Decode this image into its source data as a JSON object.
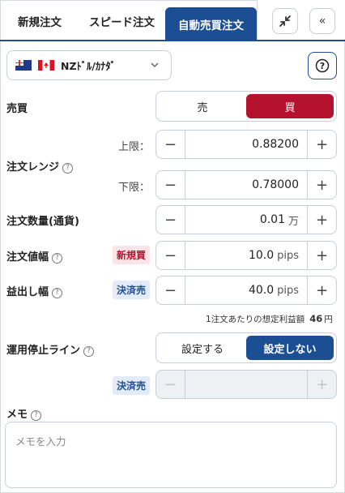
{
  "tabs": [
    {
      "label": "新規注文"
    },
    {
      "label": "スピード注文"
    },
    {
      "label": "自動売買注文"
    }
  ],
  "toolbar": {
    "back_label": "«"
  },
  "pair": {
    "name": "NZﾄﾞﾙ/ｶﾅﾀﾞ"
  },
  "trade": {
    "label": "売買",
    "sell_label": "売",
    "buy_label": "買",
    "selected": "買"
  },
  "range": {
    "label": "注文レンジ",
    "upper_label": "上限：",
    "upper_value": "0.88200",
    "lower_label": "下限：",
    "lower_value": "0.78000"
  },
  "quantity": {
    "label": "注文数量(通貨)",
    "value": "0.01",
    "unit": "万"
  },
  "order_width": {
    "label": "注文値幅",
    "badge": "新規買",
    "value": "10.0",
    "unit": "pips"
  },
  "profit_width": {
    "label": "益出し幅",
    "badge": "決済売",
    "value": "40.0",
    "unit": "pips"
  },
  "profit_note": {
    "text": "1注文あたりの想定利益額",
    "amount": "46",
    "unit": "円"
  },
  "stop_line": {
    "label": "運用停止ライン",
    "on_label": "設定する",
    "off_label": "設定しない",
    "selected": "設定しない",
    "badge": "決済売"
  },
  "memo": {
    "label": "メモ",
    "placeholder": "メモを入力"
  },
  "stepper": {
    "minus": "−",
    "plus": "+"
  },
  "help": {
    "glyph": "?"
  },
  "colors": {
    "accent": "#1c4e94",
    "buy": "#b5122f"
  }
}
